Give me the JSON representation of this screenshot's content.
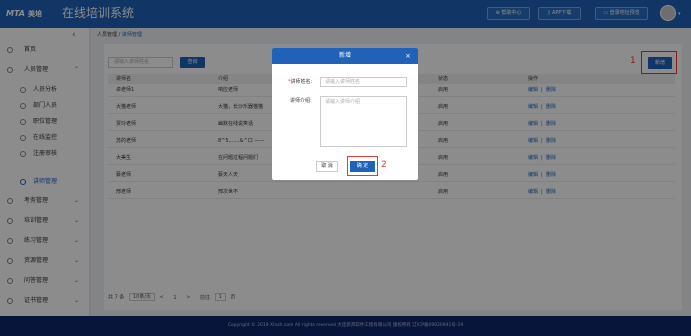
{
  "header": {
    "logo_text": "MTA",
    "logo_sub": "美培",
    "title": "在线培训系统",
    "buttons": [
      "帮助中心",
      "APP下载",
      "登录地址预览"
    ]
  },
  "sidebar": {
    "items": [
      {
        "label": "首页",
        "icon": "home-icon",
        "sub": false
      },
      {
        "label": "人员管理",
        "icon": "user-icon",
        "sub": false,
        "chevron": "up"
      },
      {
        "label": "人员分析",
        "icon": "user-icon",
        "sub": true
      },
      {
        "label": "部门人员",
        "icon": "users-icon",
        "sub": true
      },
      {
        "label": "职位管理",
        "icon": "briefcase-icon",
        "sub": true
      },
      {
        "label": "在线监控",
        "icon": "monitor-icon",
        "sub": true
      },
      {
        "label": "注册审核",
        "icon": "check-icon",
        "sub": true
      },
      {
        "label": "讲师管理",
        "icon": "teacher-icon",
        "sub": true,
        "active": true
      },
      {
        "label": "考务管理",
        "icon": "exam-icon",
        "sub": false,
        "chevron": "down"
      },
      {
        "label": "培训管理",
        "icon": "book-icon",
        "sub": false,
        "chevron": "down"
      },
      {
        "label": "练习管理",
        "icon": "edit-icon",
        "sub": false,
        "chevron": "down"
      },
      {
        "label": "资源管理",
        "icon": "folder-icon",
        "sub": false,
        "chevron": "down"
      },
      {
        "label": "问答管理",
        "icon": "question-icon",
        "sub": false,
        "chevron": "down"
      },
      {
        "label": "证书管理",
        "icon": "certificate-icon",
        "sub": false,
        "chevron": "down"
      }
    ]
  },
  "breadcrumb": {
    "parent": "人员管理",
    "sep": "/",
    "current": "讲师管理"
  },
  "search": {
    "placeholder": "请输入讲师姓名",
    "query_label": "查询"
  },
  "add_label": "新增",
  "annotations": {
    "one": "1",
    "two": "2"
  },
  "table": {
    "headers": [
      "讲师名",
      "介绍",
      "",
      "状态",
      "操作"
    ],
    "rows": [
      {
        "name": "卓老师1",
        "intro": "响应老师",
        "status": "启用",
        "edit": "编辑",
        "sep": "|",
        "del": "删除"
      },
      {
        "name": "大猫老师",
        "intro": "大猫，长沙乐器猫猫",
        "status": "启用",
        "edit": "编辑",
        "sep": "|",
        "del": "删除"
      },
      {
        "name": "贾玲老师",
        "intro": "幽默在线说笑话",
        "status": "启用",
        "edit": "编辑",
        "sep": "|",
        "del": "删除"
      },
      {
        "name": "苏的老师",
        "intro": "8^5,......&^口 ——",
        "status": "启用",
        "edit": "编辑",
        "sep": "|",
        "del": "删除"
      },
      {
        "name": "大美生",
        "intro": "在问题过程问题们",
        "status": "启用",
        "edit": "编辑",
        "sep": "|",
        "del": "删除"
      },
      {
        "name": "蔡老师",
        "intro": "蔡天人天",
        "status": "启用",
        "edit": "编辑",
        "sep": "|",
        "del": "删除"
      },
      {
        "name": "邢老师",
        "intro": "邢次世不",
        "status": "启用",
        "edit": "编辑",
        "sep": "|",
        "del": "删除"
      }
    ]
  },
  "pager": {
    "total": "共 7 条",
    "page_size": "10条/页",
    "prev": "<",
    "page": "1",
    "next": ">",
    "goto": "前往",
    "goto_value": "1",
    "page_unit": "页"
  },
  "footer": "Copyright © 2019 Xinzh.com All rights reserved 大连新邦软件工程有限公司 版权所有 辽ICP备09020941号-19",
  "dialog": {
    "title": "新增",
    "close": "×",
    "name_label": "讲师姓名:",
    "name_placeholder": "请输入讲师姓名",
    "intro_label": "讲师介绍:",
    "intro_placeholder": "请输入讲师介绍",
    "required_mark": "*",
    "cancel_label": "取 消",
    "ok_label": "确 定"
  },
  "colors": {
    "brand": "#1f62b8",
    "highlight": "#e53935",
    "footer": "#10276b"
  }
}
